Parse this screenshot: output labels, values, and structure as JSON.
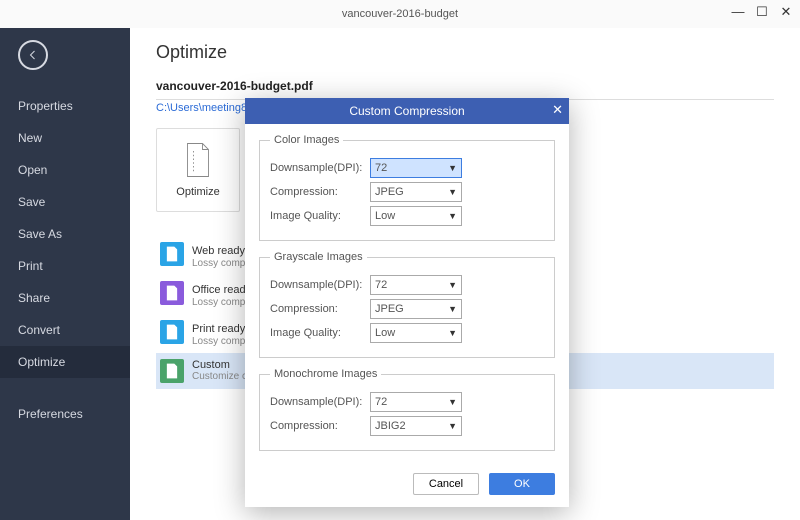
{
  "window": {
    "title": "vancouver-2016-budget"
  },
  "sidebar": {
    "items": [
      "Properties",
      "New",
      "Open",
      "Save",
      "Save As",
      "Print",
      "Share",
      "Convert",
      "Optimize"
    ],
    "preferences": "Preferences",
    "active": 8
  },
  "page": {
    "title": "Optimize",
    "file_name": "vancouver-2016-budget.pdf",
    "file_path": "C:\\Users\\meeting811\\Desktop\\vancouver-2016-budget.pdf",
    "tile_label": "Optimize"
  },
  "presets": [
    {
      "color": "#2aa4e6",
      "t1": "Web ready（s",
      "t2": "Lossy compres"
    },
    {
      "color": "#8a5bdc",
      "t1": "Office ready（",
      "t2": "Lossy compres"
    },
    {
      "color": "#2aa4e6",
      "t1": "Print ready（la",
      "t2": "Lossy compres"
    },
    {
      "color": "#4aa36a",
      "t1": "Custom",
      "t2": "Customize cor"
    }
  ],
  "dialog": {
    "title": "Custom Compression",
    "groups": {
      "color": {
        "legend": "Color Images",
        "downsample_lbl": "Downsample(DPI):",
        "downsample": "72",
        "compression_lbl": "Compression:",
        "compression": "JPEG",
        "quality_lbl": "Image Quality:",
        "quality": "Low"
      },
      "gray": {
        "legend": "Grayscale Images",
        "downsample_lbl": "Downsample(DPI):",
        "downsample": "72",
        "compression_lbl": "Compression:",
        "compression": "JPEG",
        "quality_lbl": "Image Quality:",
        "quality": "Low"
      },
      "mono": {
        "legend": "Monochrome Images",
        "downsample_lbl": "Downsample(DPI):",
        "downsample": "72",
        "compression_lbl": "Compression:",
        "compression": "JBIG2"
      }
    },
    "cancel": "Cancel",
    "ok": "OK"
  }
}
